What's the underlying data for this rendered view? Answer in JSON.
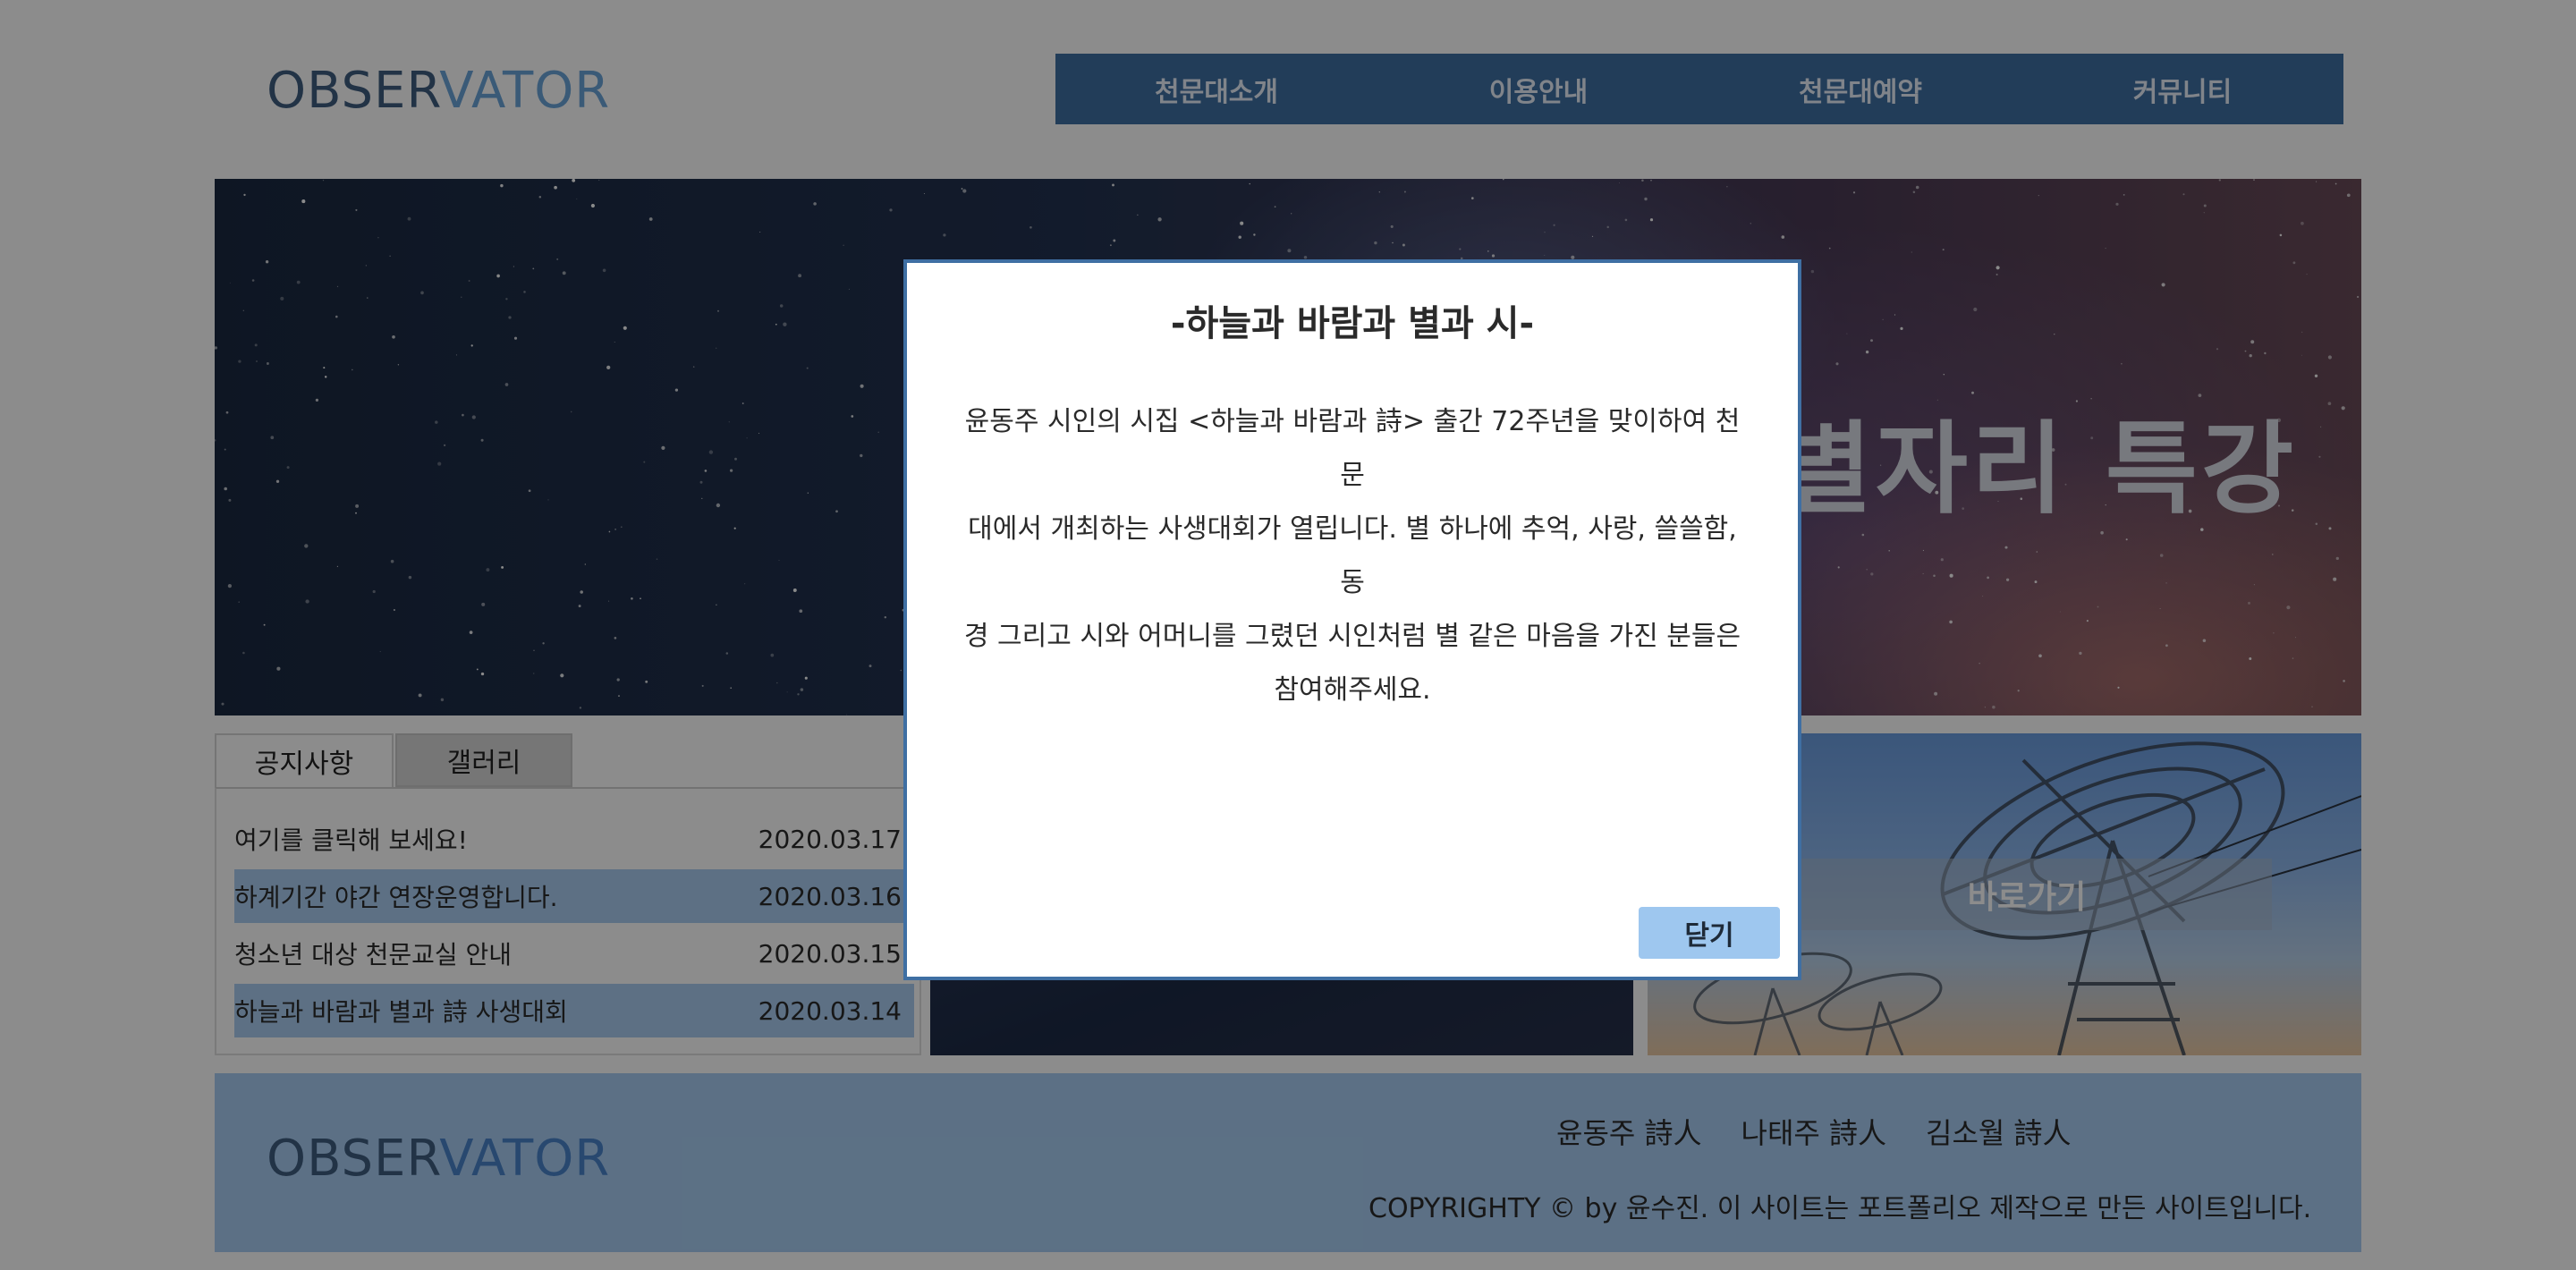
{
  "header": {
    "logo_part1": "OBSER",
    "logo_part2": "VATOR",
    "nav": [
      "천문대소개",
      "이용안내",
      "천문대예약",
      "커뮤니티"
    ]
  },
  "hero": {
    "title": "별자리 특강"
  },
  "tabs": [
    "공지사항",
    "갤러리"
  ],
  "notices": [
    {
      "title": "여기를 클릭해 보세요!",
      "date": "2020.03.17"
    },
    {
      "title": "하계기간 야간 연장운영합니다.",
      "date": "2020.03.16"
    },
    {
      "title": "청소년 대상 천문교실 안내",
      "date": "2020.03.15"
    },
    {
      "title": "하늘과 바람과 별과 詩 사생대회",
      "date": "2020.03.14"
    }
  ],
  "shortcut": {
    "label": "바로가기"
  },
  "footer": {
    "logo_part1": "OBSER",
    "logo_part2": "VATOR",
    "links": [
      "윤동주 詩人",
      "나태주 詩人",
      "김소월 詩人"
    ],
    "copyright": "COPYRIGHTY © by 윤수진. 이 사이트는 포트폴리오 제작으로 만든 사이트입니다."
  },
  "modal": {
    "title": "-하늘과 바람과 별과 시-",
    "body_lines": [
      "윤동주 시인의 시집 <하늘과 바람과 詩> 출간 72주년을 맞이하여 천문",
      "대에서 개최하는 사생대회가 열립니다. 별 하나에 추억, 사랑, 쓸쓸함, 동",
      "경 그리고 시와 어머니를 그렸던 시인처럼 별 같은 마음을 가진 분들은",
      "참여해주세요."
    ],
    "close_label": "닫기"
  },
  "colors": {
    "nav_bg": "#3f6fa3",
    "footer_bg": "#a8cdf3",
    "highlight_row": "#a9cdf0",
    "close_button": "#9ec7ef"
  }
}
